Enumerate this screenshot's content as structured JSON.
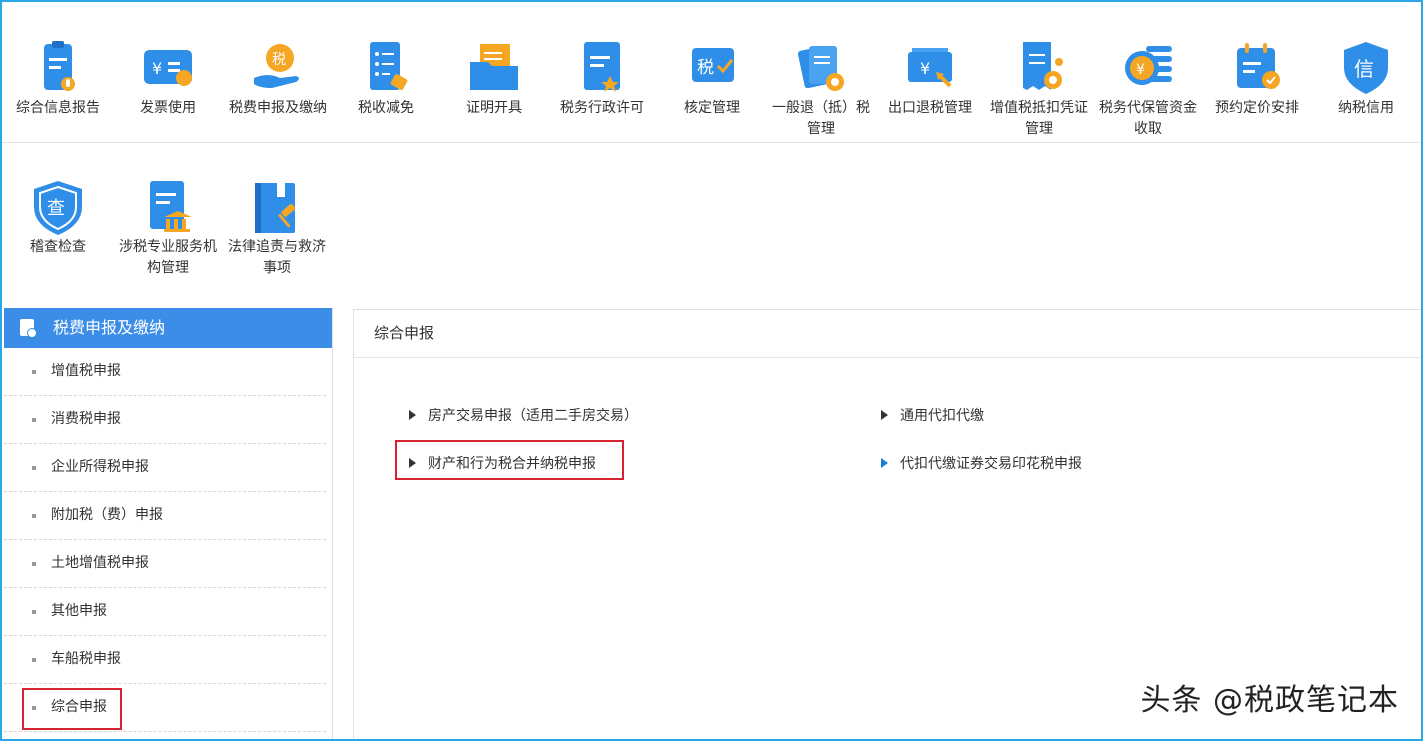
{
  "top_tiles": [
    {
      "label": "综合信息报告",
      "icon": "report-mic-icon"
    },
    {
      "label": "发票使用",
      "icon": "invoice-icon"
    },
    {
      "label": "税费申报及缴纳",
      "icon": "tax-payment-hand-icon"
    },
    {
      "label": "税收减免",
      "icon": "tax-reduction-list-icon"
    },
    {
      "label": "证明开具",
      "icon": "certificate-folder-icon"
    },
    {
      "label": "税务行政许可",
      "icon": "admin-permit-icon"
    },
    {
      "label": "核定管理",
      "icon": "tax-approve-icon"
    },
    {
      "label": "一般退（抵）税管理",
      "icon": "refund-gear-icon"
    },
    {
      "label": "出口退税管理",
      "icon": "export-refund-icon"
    },
    {
      "label": "增值税抵扣凭证管理",
      "icon": "vat-voucher-gear-icon"
    },
    {
      "label": "税务代保管资金收取",
      "icon": "coin-stack-icon"
    },
    {
      "label": "预约定价安排",
      "icon": "calendar-check-icon"
    },
    {
      "label": "纳税信用",
      "icon": "credit-shield-icon"
    }
  ],
  "second_tiles": [
    {
      "label": "稽查检查",
      "icon": "inspection-shield-icon"
    },
    {
      "label": "涉税专业服务机构管理",
      "icon": "institution-doc-icon"
    },
    {
      "label": "法律追责与救济事项",
      "icon": "law-book-gavel-icon"
    }
  ],
  "sidebar": {
    "title": "税费申报及缴纳",
    "items": [
      {
        "label": "增值税申报"
      },
      {
        "label": "消费税申报"
      },
      {
        "label": "企业所得税申报"
      },
      {
        "label": "附加税（费）申报"
      },
      {
        "label": "土地增值税申报"
      },
      {
        "label": "其他申报"
      },
      {
        "label": "车船税申报"
      },
      {
        "label": "综合申报"
      }
    ]
  },
  "main": {
    "title": "综合申报",
    "links": [
      {
        "label": "房产交易申报（适用二手房交易）"
      },
      {
        "label": "通用代扣代缴"
      },
      {
        "label": "财产和行为税合并纳税申报"
      },
      {
        "label": "代扣代缴证券交易印花税申报"
      }
    ]
  },
  "watermark": "头条 @税政笔记本",
  "colors": {
    "accent": "#3c8de8",
    "border": "#2aa7e6",
    "highlight": "#d6232f",
    "icon_blue": "#2f8fe8",
    "icon_orange": "#f5a623"
  }
}
